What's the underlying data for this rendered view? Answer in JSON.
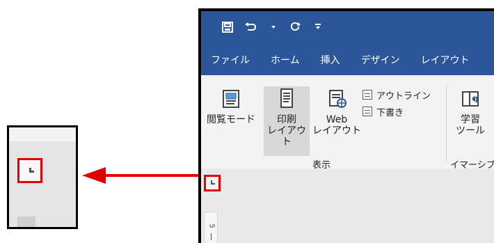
{
  "qat": {
    "save_icon": "save-icon",
    "undo_icon": "undo-icon",
    "undo_dropdown_icon": "dropdown-icon",
    "redo_icon": "redo-icon",
    "customize_icon": "customize-icon"
  },
  "tabs": [
    {
      "label": "ファイル"
    },
    {
      "label": "ホーム"
    },
    {
      "label": "挿入"
    },
    {
      "label": "デザイン"
    },
    {
      "label": "レイアウト"
    }
  ],
  "ribbon": {
    "read_mode_label": "閲覧モード",
    "print_layout_label_line1": "印刷",
    "print_layout_label_line2": "レイアウト",
    "web_layout_label_line1": "Web",
    "web_layout_label_line2": "レイアウト",
    "outline_label": "アウトライン",
    "draft_label": "下書き",
    "learning_tools_label_line1": "学習",
    "learning_tools_label_line2": "ツール",
    "group_view_label": "表示",
    "group_immersive_label": "イマーシブ"
  },
  "ruler": {
    "vertical_number": "5"
  },
  "colors": {
    "word_blue": "#2b579a",
    "highlight_red": "#e00000"
  }
}
